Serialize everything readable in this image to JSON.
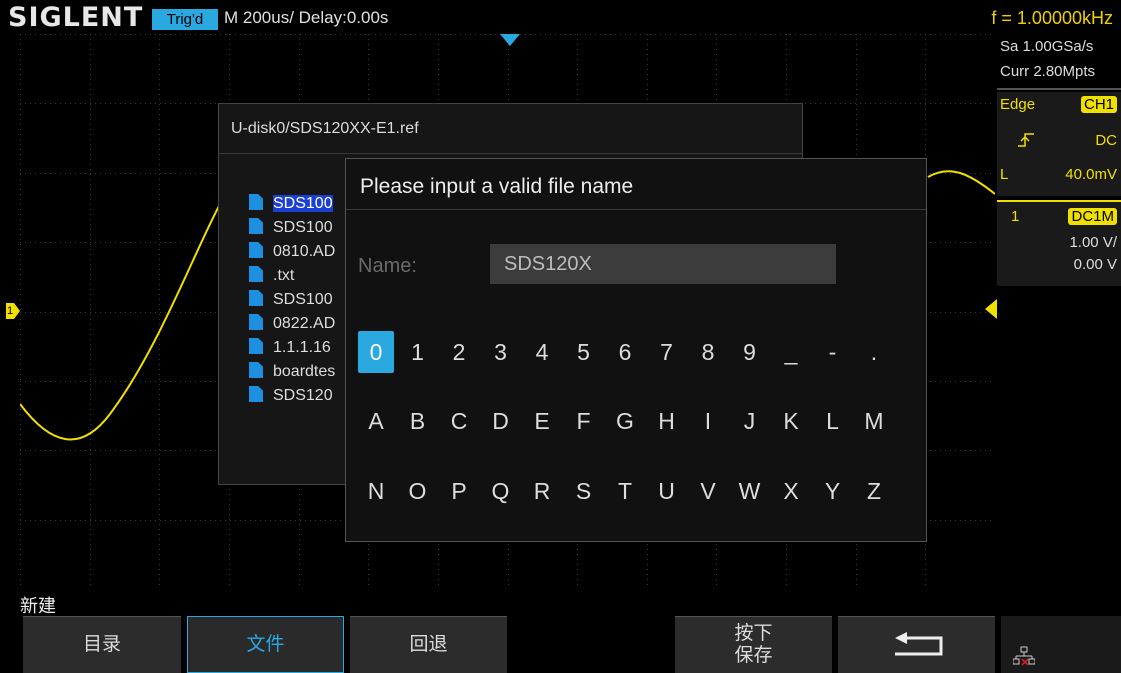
{
  "topbar": {
    "brand": "SIGLENT",
    "trigger_status": "Trig'd",
    "timebase": "M 200us/  Delay:0.00s",
    "frequency": "f = 1.00000kHz"
  },
  "right_panel": {
    "sample_rate": "Sa 1.00GSa/s",
    "memory_depth": "Curr 2.80Mpts",
    "trigger_type": "Edge",
    "trigger_source": "CH1",
    "trigger_coupling": "DC",
    "trigger_level_label": "L",
    "trigger_level": "40.0mV",
    "channel_number": "1",
    "channel_coupling": "DC1M",
    "channel_scale": "1.00 V/",
    "channel_offset": "0.00 V"
  },
  "markers": {
    "channel_marker": "1"
  },
  "file_dialog": {
    "path": "U-disk0/SDS120XX-E1.ref",
    "files": [
      {
        "name": "SDS100",
        "selected": true
      },
      {
        "name": "SDS100",
        "selected": false
      },
      {
        "name": "0810.AD",
        "selected": false
      },
      {
        "name": ".txt",
        "selected": false
      },
      {
        "name": "SDS100",
        "selected": false
      },
      {
        "name": "0822.AD",
        "selected": false
      },
      {
        "name": "1.1.1.16",
        "selected": false
      },
      {
        "name": "boardtes",
        "selected": false
      },
      {
        "name": "SDS120",
        "selected": false
      }
    ]
  },
  "input_dialog": {
    "title": "Please input a valid file name",
    "name_label": "Name:",
    "name_value": "SDS120X",
    "keyboard_rows": [
      [
        "0",
        "1",
        "2",
        "3",
        "4",
        "5",
        "6",
        "7",
        "8",
        "9",
        "_",
        "-",
        "."
      ],
      [
        "A",
        "B",
        "C",
        "D",
        "E",
        "F",
        "G",
        "H",
        "I",
        "J",
        "K",
        "L",
        "M"
      ],
      [
        "N",
        "O",
        "P",
        "Q",
        "R",
        "S",
        "T",
        "U",
        "V",
        "W",
        "X",
        "Y",
        "Z"
      ]
    ],
    "active_key": "0"
  },
  "softkeys": {
    "menu_title": "新建",
    "directory": "目录",
    "file": "文件",
    "back": "回退",
    "press_save_line1": "按下",
    "press_save_line2": "保存"
  },
  "colors": {
    "trace": "#f0e000",
    "accent": "#2aa8e0",
    "selection": "#1b3fd0"
  }
}
